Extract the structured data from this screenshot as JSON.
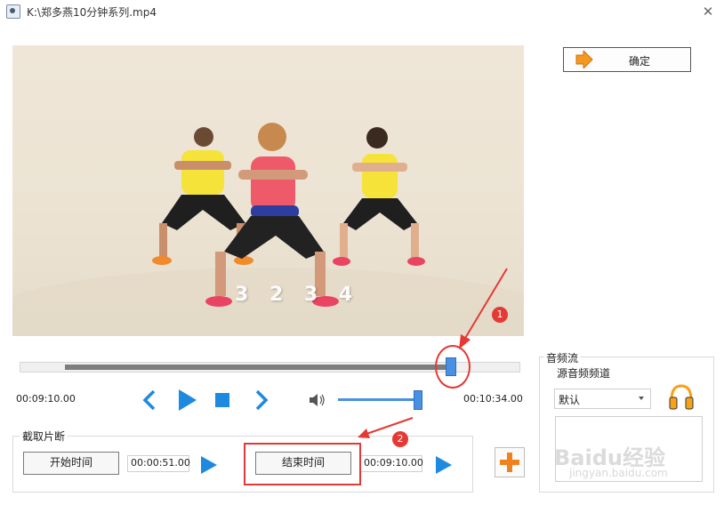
{
  "window": {
    "title": "K:\\郑多燕10分钟系列.mp4",
    "close_symbol": "✕"
  },
  "video": {
    "overlay_count": "3 2 3 4"
  },
  "confirm": {
    "label": "确定"
  },
  "timeline": {
    "progress": 0.86,
    "selection_start": 0.09,
    "selection_end": 0.86
  },
  "player": {
    "current_time": "00:09:10.00",
    "total_time": "00:10:34.00",
    "volume": 0.95
  },
  "clip": {
    "group_title": "截取片断",
    "start_label": "开始时间",
    "start_time": "00:00:51.00",
    "end_label": "结束时间",
    "end_time": "00:09:10.00"
  },
  "audio": {
    "group_title": "音频流",
    "source_label": "源音频频道",
    "selected": "默认"
  },
  "annotations": {
    "badge_1": "1",
    "badge_2": "2",
    "accent": "#e53935"
  },
  "watermark": {
    "text": "Baidu经验",
    "sub": "jingyan.baidu.com"
  },
  "icons": [
    "app-icon",
    "close-icon",
    "arrow-right-icon",
    "prev-icon",
    "play-icon",
    "stop-icon",
    "next-icon",
    "speaker-icon",
    "plus-icon",
    "headphone-icon"
  ]
}
